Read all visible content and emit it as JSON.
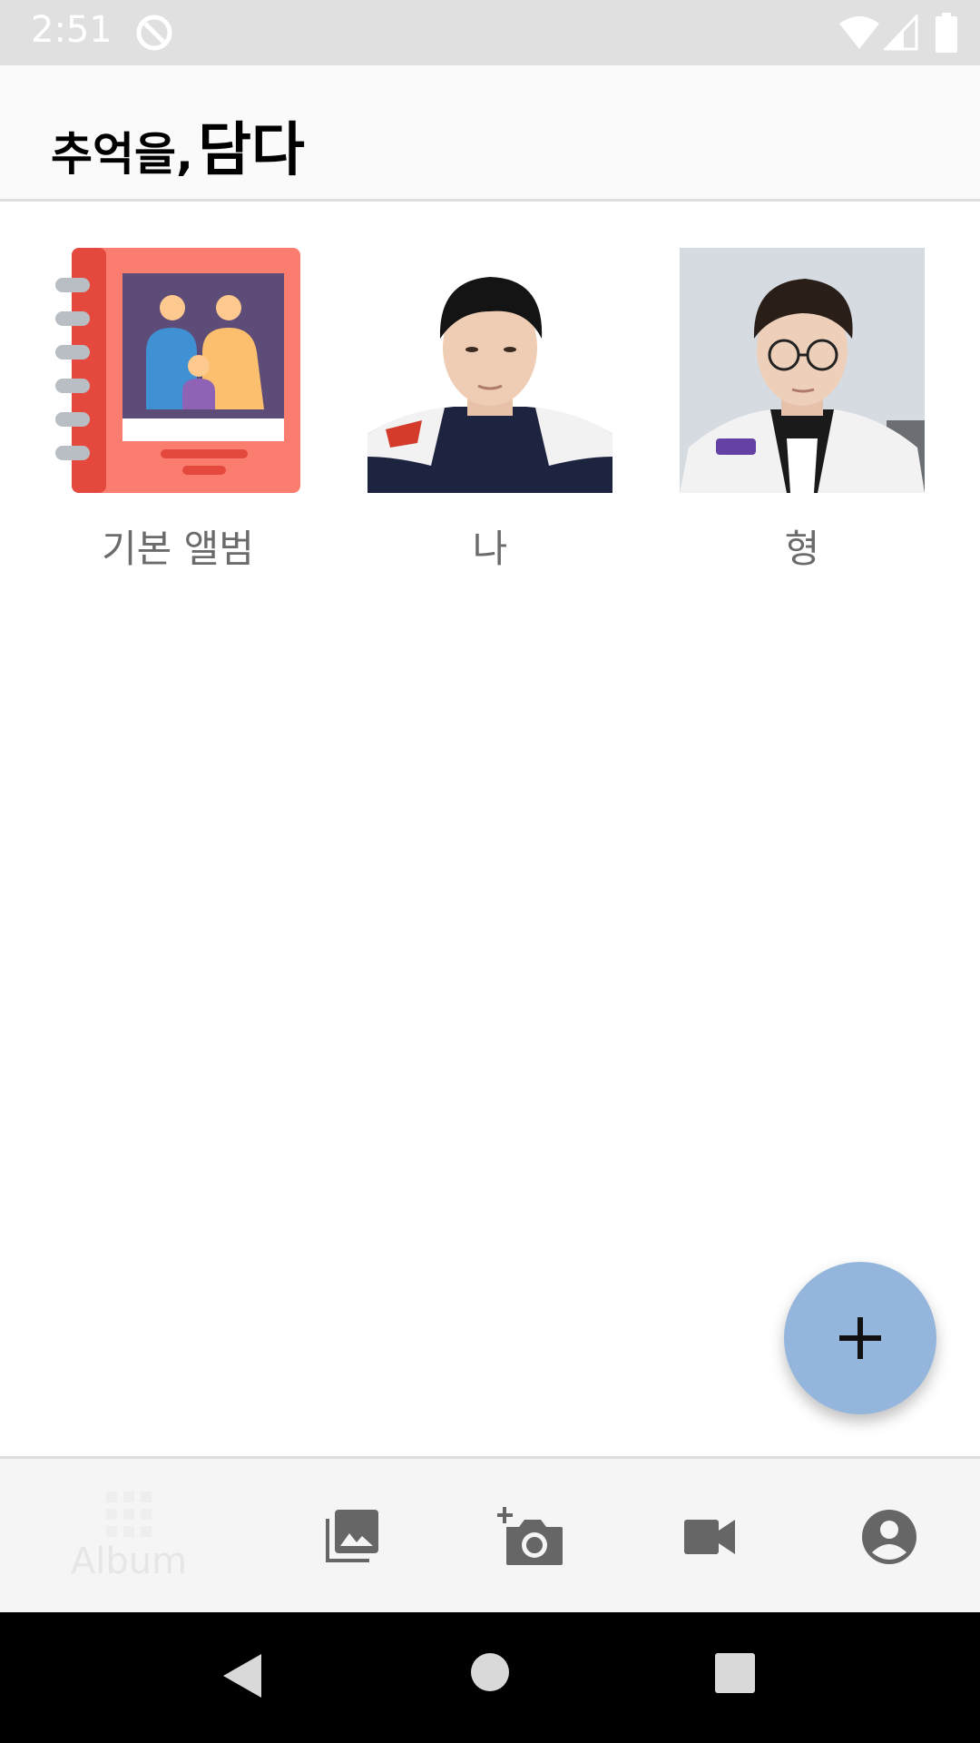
{
  "status_bar": {
    "time": "2:51",
    "icons": [
      "notification-icon",
      "wifi-icon",
      "signal-icon",
      "battery-icon"
    ]
  },
  "app_bar": {
    "title_part1": "추억을,",
    "title_part2": "담다"
  },
  "albums": [
    {
      "label": "기본 앨범",
      "thumb": "photo-album-icon"
    },
    {
      "label": "나",
      "thumb": "person-photo"
    },
    {
      "label": "형",
      "thumb": "person-photo-glasses"
    }
  ],
  "fab": {
    "icon": "plus-icon",
    "color": "#94b6dd"
  },
  "bottom_nav": {
    "items": [
      {
        "label": "Album",
        "icon": "grid-icon",
        "selected": true
      },
      {
        "label": "",
        "icon": "photo-library-icon"
      },
      {
        "label": "",
        "icon": "add-camera-icon"
      },
      {
        "label": "",
        "icon": "video-camera-icon"
      },
      {
        "label": "",
        "icon": "account-circle-icon"
      }
    ]
  },
  "system_nav": {
    "icons": [
      "back-icon",
      "home-icon",
      "recents-icon"
    ]
  }
}
